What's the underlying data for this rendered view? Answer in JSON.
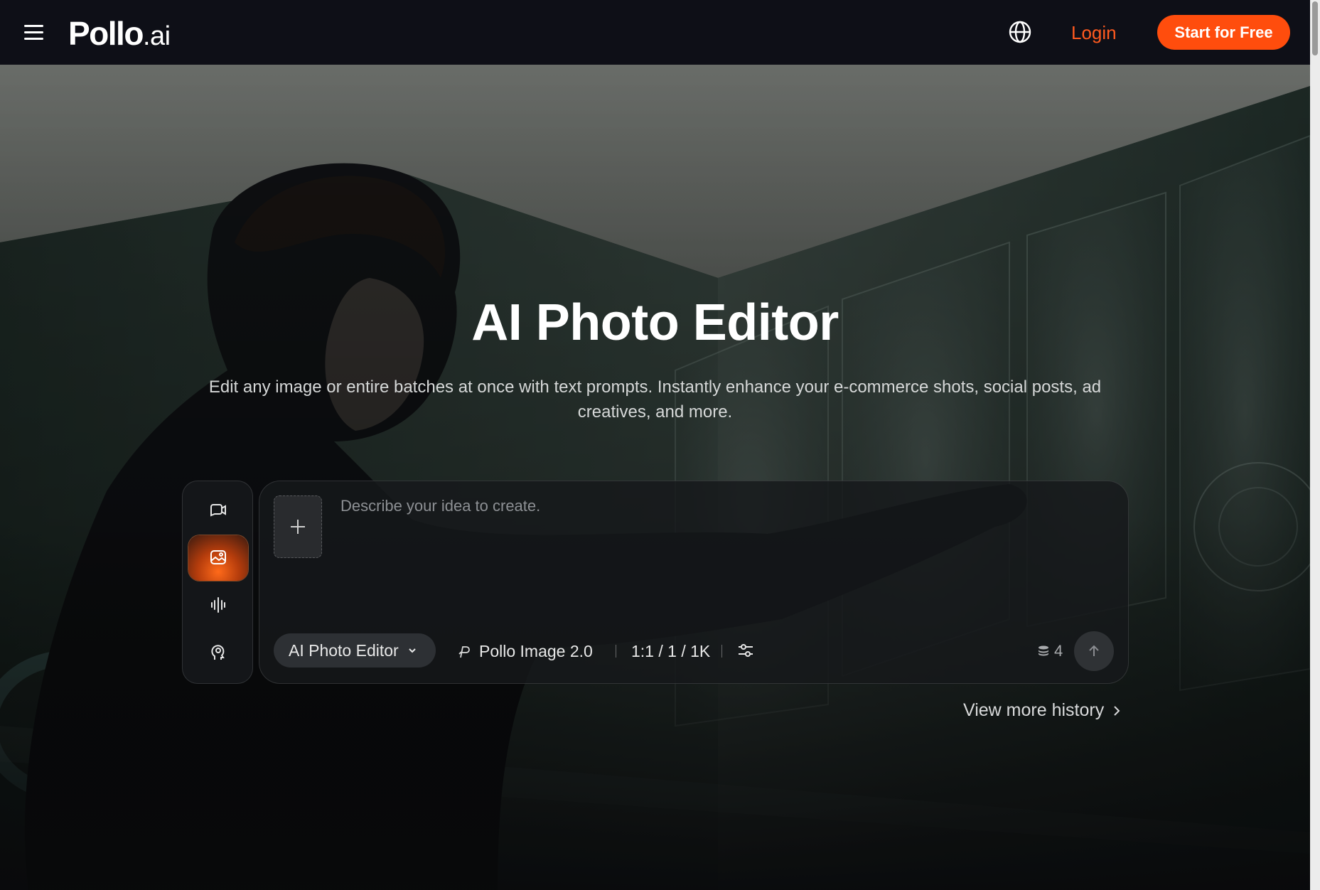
{
  "header": {
    "logo_brand": "Pollo",
    "logo_tld": ".ai",
    "login_label": "Login",
    "cta_label": "Start for Free"
  },
  "hero": {
    "title": "AI Photo Editor",
    "subtitle": "Edit any image or entire batches at once with text prompts. Instantly enhance your e-commerce shots, social posts, ad creatives, and more."
  },
  "composer": {
    "modes": [
      {
        "icon": "video-chat-icon",
        "active": false
      },
      {
        "icon": "image-edit-icon",
        "active": true
      },
      {
        "icon": "audio-wave-icon",
        "active": false
      },
      {
        "icon": "head-profile-icon",
        "active": false
      }
    ],
    "placeholder": "Describe your idea to create.",
    "tool_label": "AI Photo Editor",
    "model_label": "Pollo Image 2.0",
    "ratio_label": "1:1 / 1 / 1K",
    "credits": "4"
  },
  "history_link": "View more history",
  "colors": {
    "accent": "#ff4d0d",
    "login": "#ff5a1f",
    "header_bg": "#0e0f17"
  }
}
